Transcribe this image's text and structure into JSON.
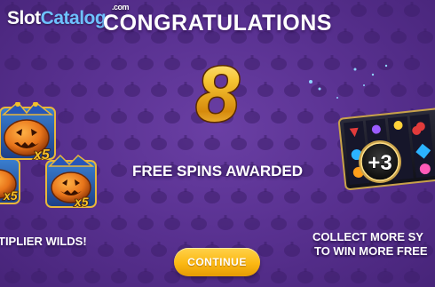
{
  "watermark": {
    "part_a": "Slot",
    "part_b": "Catalog",
    "suffix": ".com"
  },
  "title": "CONGRATULATIONS",
  "award": {
    "count": "8",
    "label": "FREE SPINS AWARDED"
  },
  "left_feature": {
    "caption": "TIPLIER WILDS!",
    "multiplier_top": "x5",
    "multiplier_bottom_left": "x5",
    "multiplier_bottom_right": "x5"
  },
  "right_feature": {
    "caption_line1": "COLLECT MORE SY",
    "caption_line2": "TO WIN MORE FREE",
    "badge": "+3"
  },
  "continue_button": {
    "label": "CONTINUE"
  },
  "colors": {
    "background": "#5a3292",
    "button": "#fbb813",
    "gold": "#f3c12a",
    "watermark_accent": "#6ec1ff"
  }
}
